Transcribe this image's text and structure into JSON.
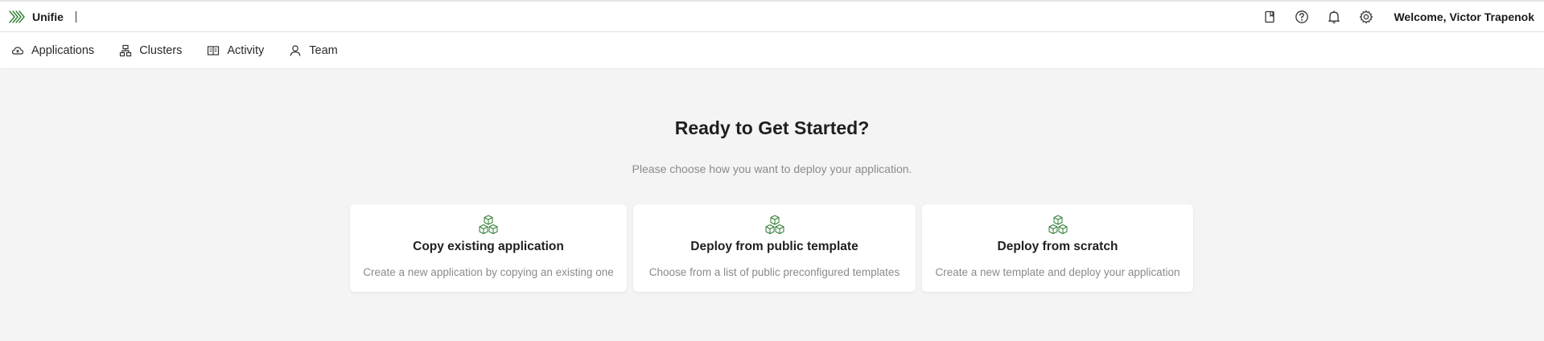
{
  "header": {
    "brand_name": "Unifie",
    "welcome": "Welcome, Victor Trapenok",
    "icons": [
      "docs-icon",
      "help-icon",
      "bell-icon",
      "gear-icon"
    ]
  },
  "nav": {
    "items": [
      {
        "label": "Applications",
        "icon": "cloud-icon"
      },
      {
        "label": "Clusters",
        "icon": "cluster-icon"
      },
      {
        "label": "Activity",
        "icon": "activity-icon"
      },
      {
        "label": "Team",
        "icon": "user-icon"
      }
    ]
  },
  "main": {
    "title": "Ready to Get Started?",
    "subtitle": "Please choose how you want to deploy your application.",
    "cards": [
      {
        "title": "Copy existing application",
        "description": "Create a new application by copying an existing one",
        "icon": "cubes-icon"
      },
      {
        "title": "Deploy from public template",
        "description": "Choose from a list of public preconfigured templates",
        "icon": "cubes-icon"
      },
      {
        "title": "Deploy from scratch",
        "description": "Create a new template and deploy your application",
        "icon": "cubes-icon"
      }
    ]
  },
  "colors": {
    "brand_green": "#2e7d32",
    "page_bg": "#f4f4f4",
    "muted_text": "#8a8a8a"
  }
}
